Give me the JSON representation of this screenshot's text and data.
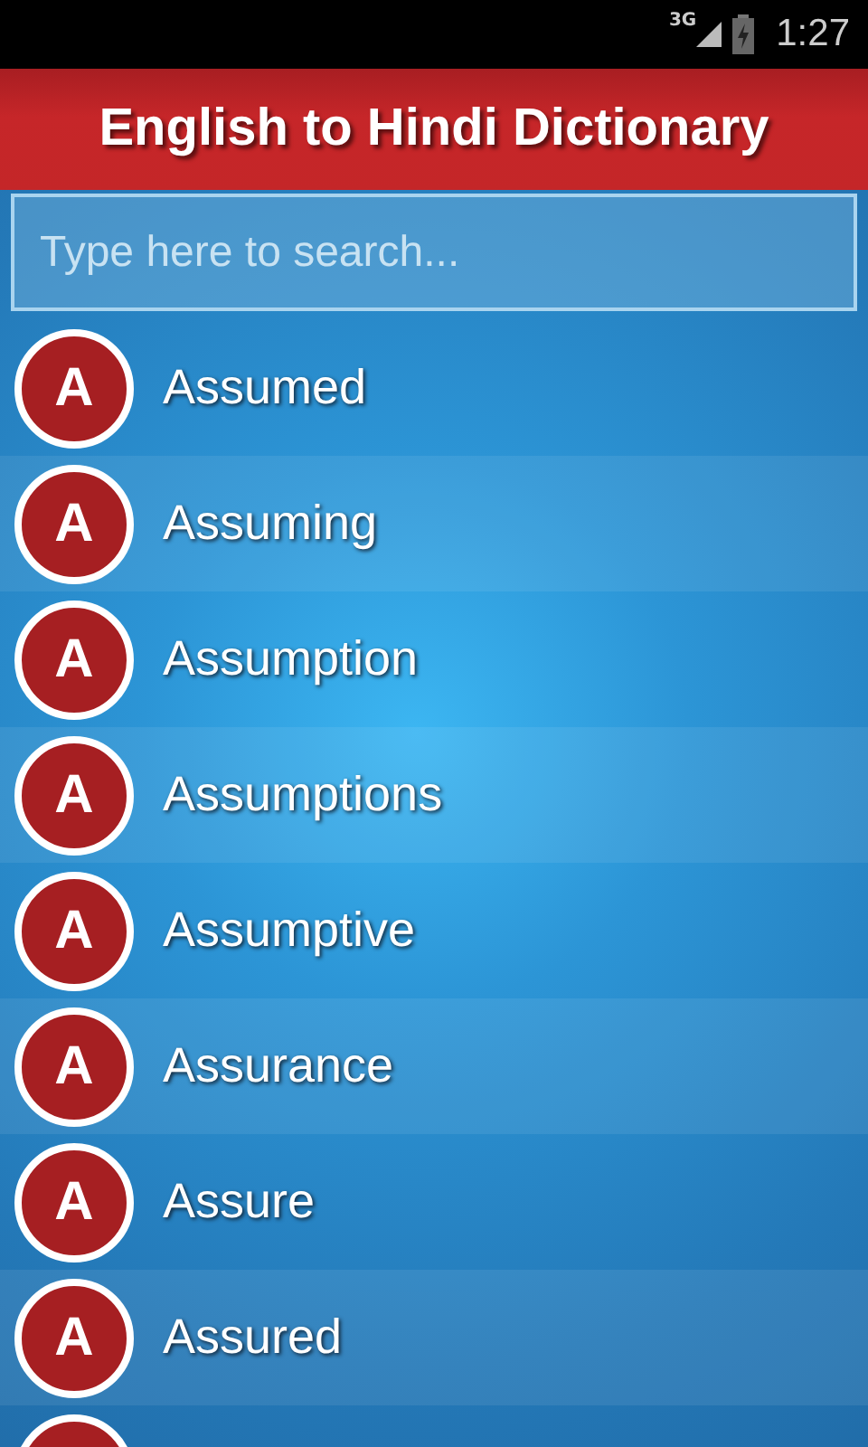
{
  "status_bar": {
    "network": "3G",
    "time": "1:27"
  },
  "header": {
    "title": "English to Hindi Dictionary"
  },
  "search": {
    "placeholder": "Type here to search..."
  },
  "words": [
    {
      "kind": "word",
      "letter": "A",
      "word": "Assumed"
    },
    {
      "kind": "word",
      "letter": "A",
      "word": "Assuming"
    },
    {
      "kind": "word",
      "letter": "A",
      "word": "Assumption"
    },
    {
      "kind": "word",
      "letter": "A",
      "word": "Assumptions"
    },
    {
      "kind": "word",
      "letter": "A",
      "word": "Assumptive"
    },
    {
      "kind": "word",
      "letter": "A",
      "word": "Assurance"
    },
    {
      "kind": "word",
      "letter": "A",
      "word": "Assure"
    },
    {
      "kind": "word",
      "letter": "A",
      "word": "Assured"
    },
    {
      "kind": "cut"
    }
  ]
}
